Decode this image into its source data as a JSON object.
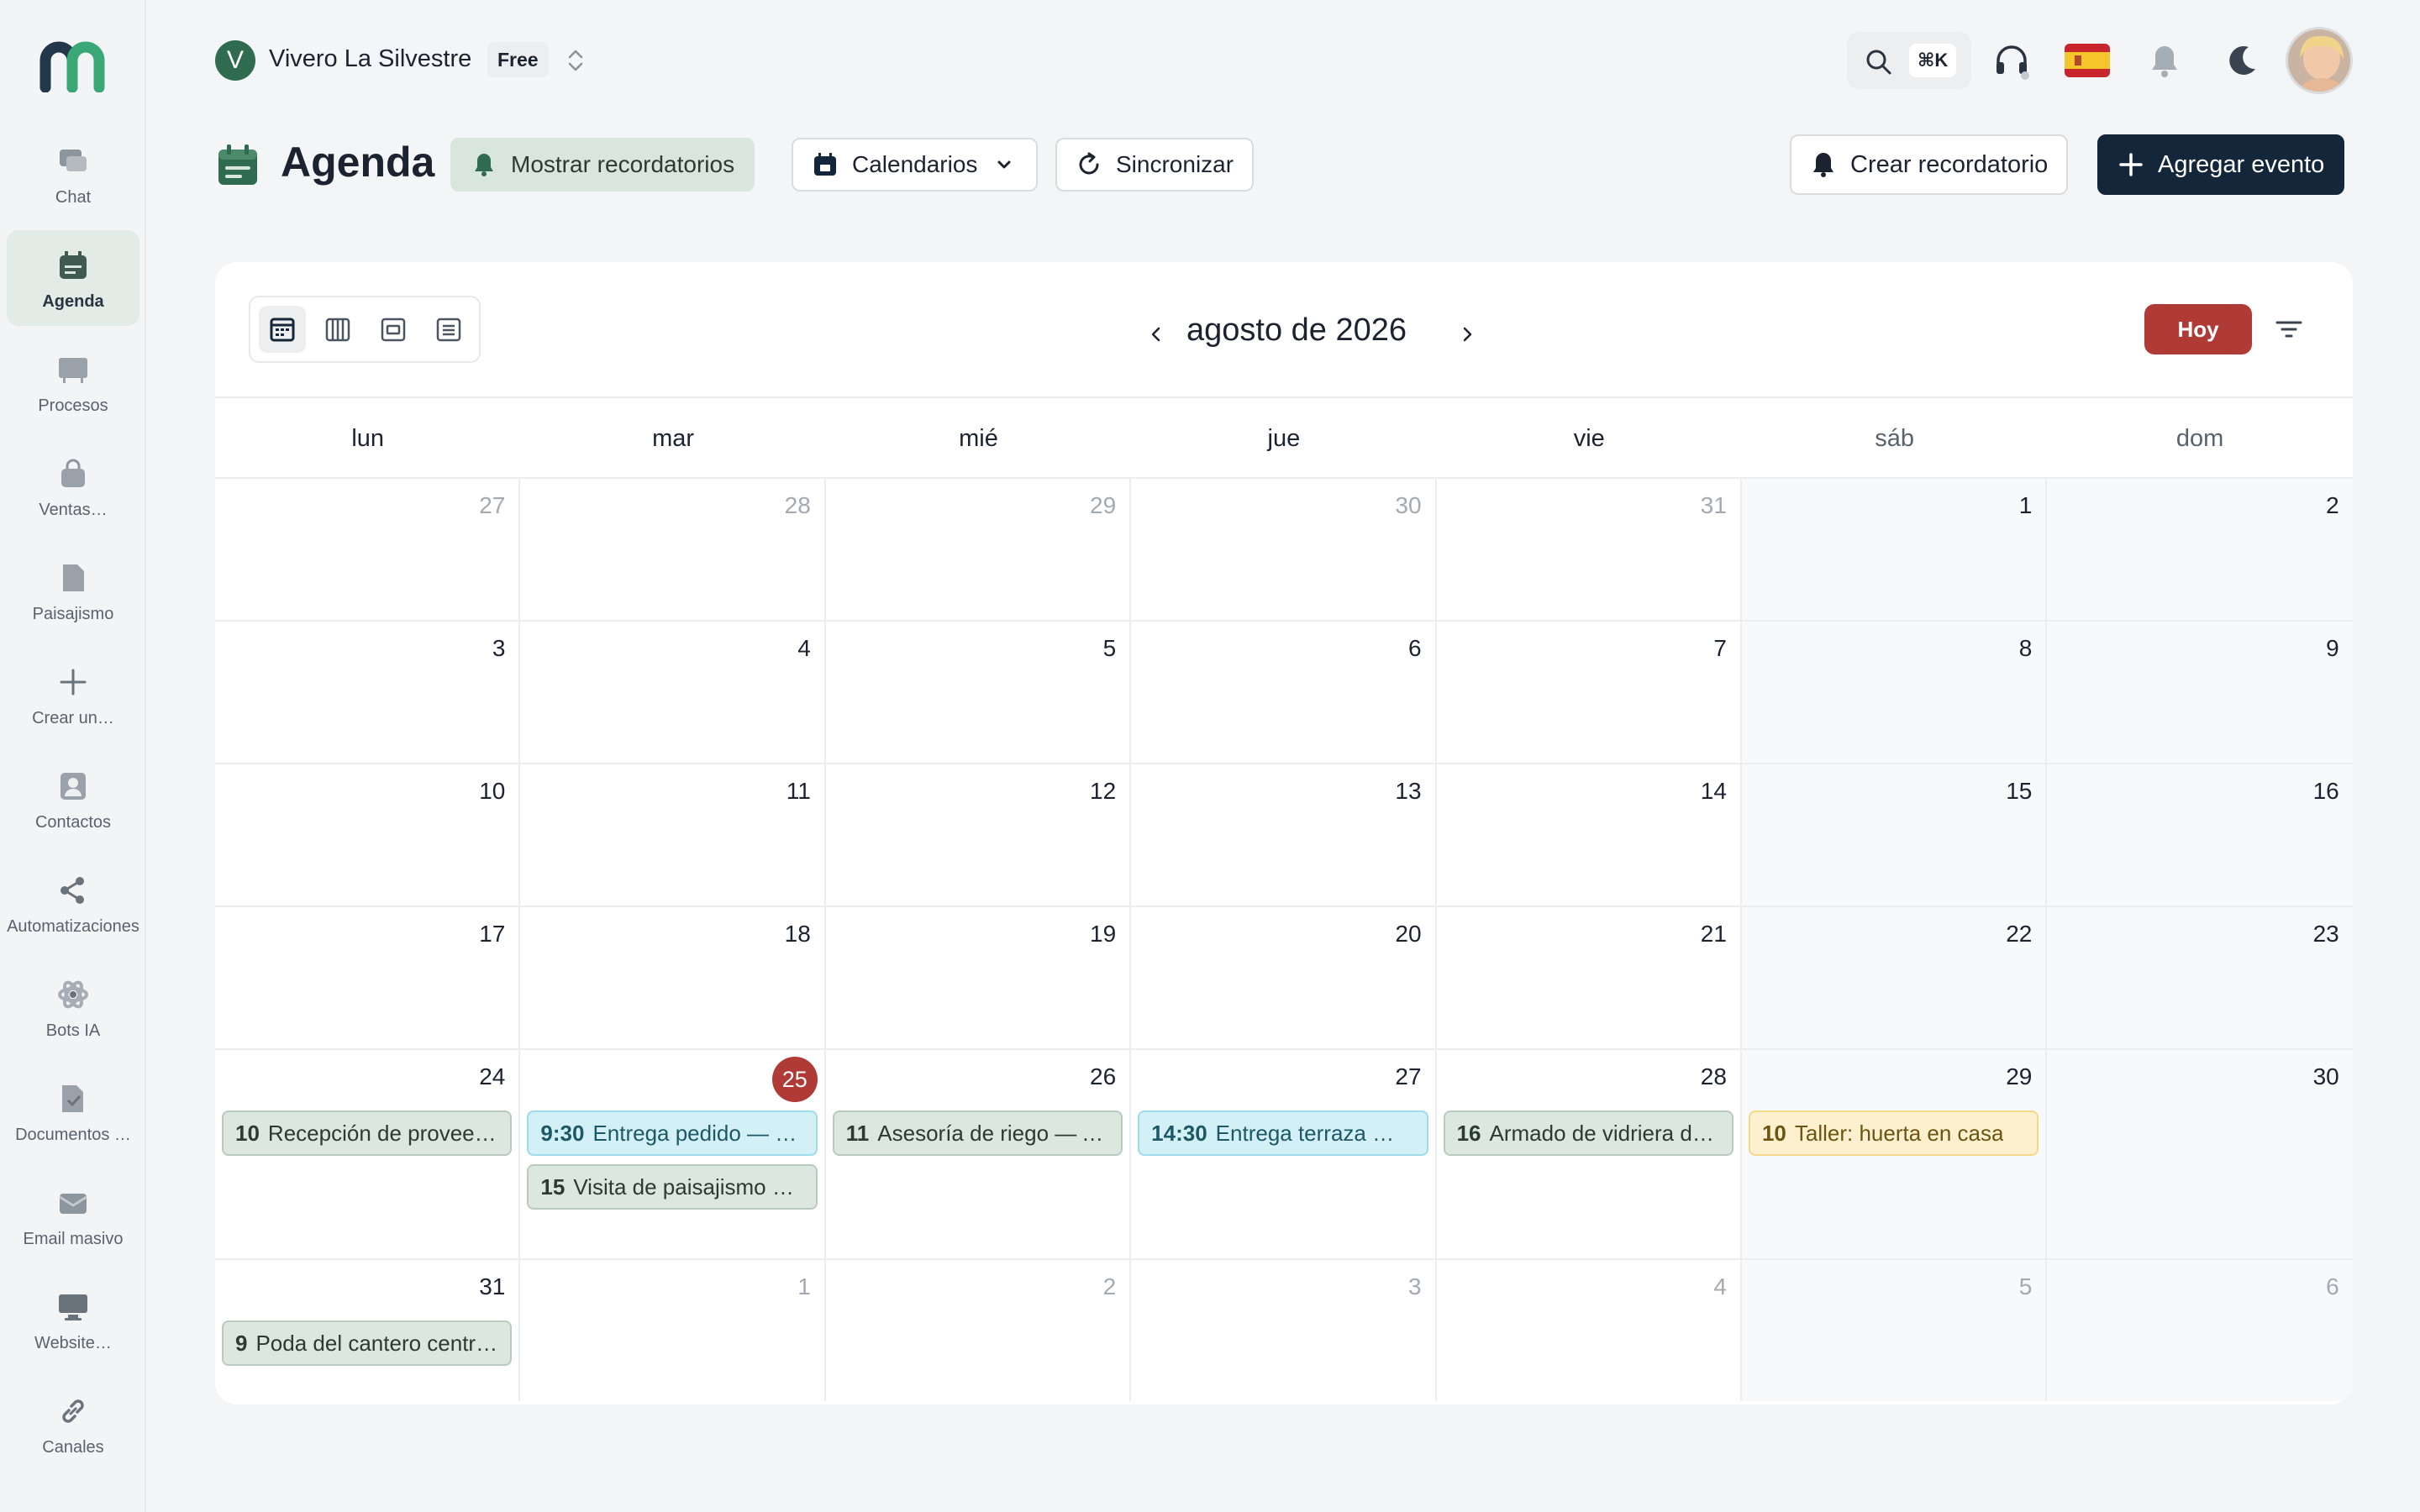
{
  "sidebar": {
    "items": [
      {
        "label": "Chat",
        "icon": "chat-icon"
      },
      {
        "label": "Agenda",
        "icon": "calendar-icon",
        "active": true
      },
      {
        "label": "Procesos",
        "icon": "board-icon"
      },
      {
        "label": "Ventas…",
        "icon": "shopping-bag-icon"
      },
      {
        "label": "Paisajismo",
        "icon": "document-icon"
      },
      {
        "label": "Crear un…",
        "icon": "plus-icon"
      },
      {
        "label": "Contactos",
        "icon": "contact-icon"
      },
      {
        "label": "Automatizaciones",
        "icon": "share-icon"
      },
      {
        "label": "Bots IA",
        "icon": "atom-icon"
      },
      {
        "label": "Documentos …",
        "icon": "document-check-icon"
      },
      {
        "label": "Email masivo",
        "icon": "mail-icon"
      },
      {
        "label": "Website…",
        "icon": "monitor-icon"
      },
      {
        "label": "Canales",
        "icon": "link-icon"
      }
    ]
  },
  "workspace": {
    "initial": "V",
    "name": "Vivero La Silvestre",
    "plan": "Free"
  },
  "topbar": {
    "shortcut": "⌘K"
  },
  "header": {
    "title": "Agenda",
    "show_reminders": "Mostrar recordatorios",
    "calendars": "Calendarios",
    "sync": "Sincronizar",
    "create_reminder": "Crear recordatorio",
    "add_event": "Agregar evento"
  },
  "calendar": {
    "month_title": "agosto de 2026",
    "today_label": "Hoy",
    "weekdays": [
      "lun",
      "mar",
      "mié",
      "jue",
      "vie",
      "sáb",
      "dom"
    ],
    "weeks": [
      [
        {
          "day": "27",
          "out": true
        },
        {
          "day": "28",
          "out": true
        },
        {
          "day": "29",
          "out": true
        },
        {
          "day": "30",
          "out": true
        },
        {
          "day": "31",
          "out": true
        },
        {
          "day": "1"
        },
        {
          "day": "2"
        }
      ],
      [
        {
          "day": "3"
        },
        {
          "day": "4"
        },
        {
          "day": "5"
        },
        {
          "day": "6"
        },
        {
          "day": "7"
        },
        {
          "day": "8"
        },
        {
          "day": "9"
        }
      ],
      [
        {
          "day": "10"
        },
        {
          "day": "11"
        },
        {
          "day": "12"
        },
        {
          "day": "13"
        },
        {
          "day": "14"
        },
        {
          "day": "15"
        },
        {
          "day": "16"
        }
      ],
      [
        {
          "day": "17"
        },
        {
          "day": "18"
        },
        {
          "day": "19"
        },
        {
          "day": "20"
        },
        {
          "day": "21"
        },
        {
          "day": "22"
        },
        {
          "day": "23"
        }
      ],
      [
        {
          "day": "24",
          "events": [
            {
              "time": "10",
              "title": "Recepción de provee…",
              "color": "green"
            }
          ]
        },
        {
          "day": "25",
          "today": true,
          "events": [
            {
              "time": "9:30",
              "title": "Entrega pedido — …",
              "color": "cyan"
            },
            {
              "time": "15",
              "title": "Visita de paisajismo —…",
              "color": "green"
            }
          ]
        },
        {
          "day": "26",
          "events": [
            {
              "time": "11",
              "title": "Asesoría de riego — A…",
              "color": "green"
            }
          ]
        },
        {
          "day": "27",
          "events": [
            {
              "time": "14:30",
              "title": "Entrega terraza — …",
              "color": "cyan"
            }
          ]
        },
        {
          "day": "28",
          "events": [
            {
              "time": "16",
              "title": "Armado de vidriera de…",
              "color": "green"
            }
          ]
        },
        {
          "day": "29",
          "events": [
            {
              "time": "10",
              "title": "Taller: huerta en casa",
              "color": "yellow"
            }
          ]
        },
        {
          "day": "30"
        }
      ],
      [
        {
          "day": "31",
          "events": [
            {
              "time": "9",
              "title": "Poda del cantero centr…",
              "color": "green"
            }
          ]
        },
        {
          "day": "1",
          "out": true
        },
        {
          "day": "2",
          "out": true
        },
        {
          "day": "3",
          "out": true
        },
        {
          "day": "4",
          "out": true
        },
        {
          "day": "5",
          "out": true
        },
        {
          "day": "6",
          "out": true
        }
      ]
    ]
  },
  "colors": {
    "brand": "#2f6b4f",
    "primary_dark": "#14263a",
    "today": "#b03a36"
  }
}
